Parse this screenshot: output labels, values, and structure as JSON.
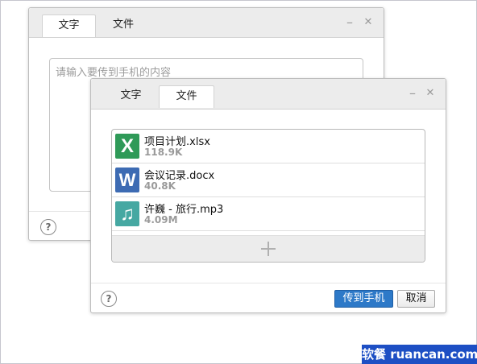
{
  "back_dialog": {
    "tabs": [
      {
        "label": "文字",
        "active": true
      },
      {
        "label": "文件",
        "active": false
      }
    ],
    "textarea_placeholder": "请输入要传到手机的内容",
    "minimize_glyph": "–",
    "close_glyph": "✕",
    "help_glyph": "?"
  },
  "front_dialog": {
    "tabs": [
      {
        "label": "文字",
        "active": false
      },
      {
        "label": "文件",
        "active": true
      }
    ],
    "minimize_glyph": "–",
    "close_glyph": "✕",
    "files": [
      {
        "name": "项目计划.xlsx",
        "size": "118.9K",
        "icon": "excel-icon",
        "glyph": "X",
        "color": "#2f9a58"
      },
      {
        "name": "会议记录.docx",
        "size": "40.8K",
        "icon": "word-icon",
        "glyph": "W",
        "color": "#3d6bb3"
      },
      {
        "name": "许巍 - 旅行.mp3",
        "size": "4.09M",
        "icon": "music-icon",
        "glyph": "♫",
        "color": "#46a8a2"
      }
    ],
    "help_glyph": "?",
    "send_button": "传到手机",
    "cancel_button": "取消"
  },
  "watermark": "软餐 ruancan.com"
}
